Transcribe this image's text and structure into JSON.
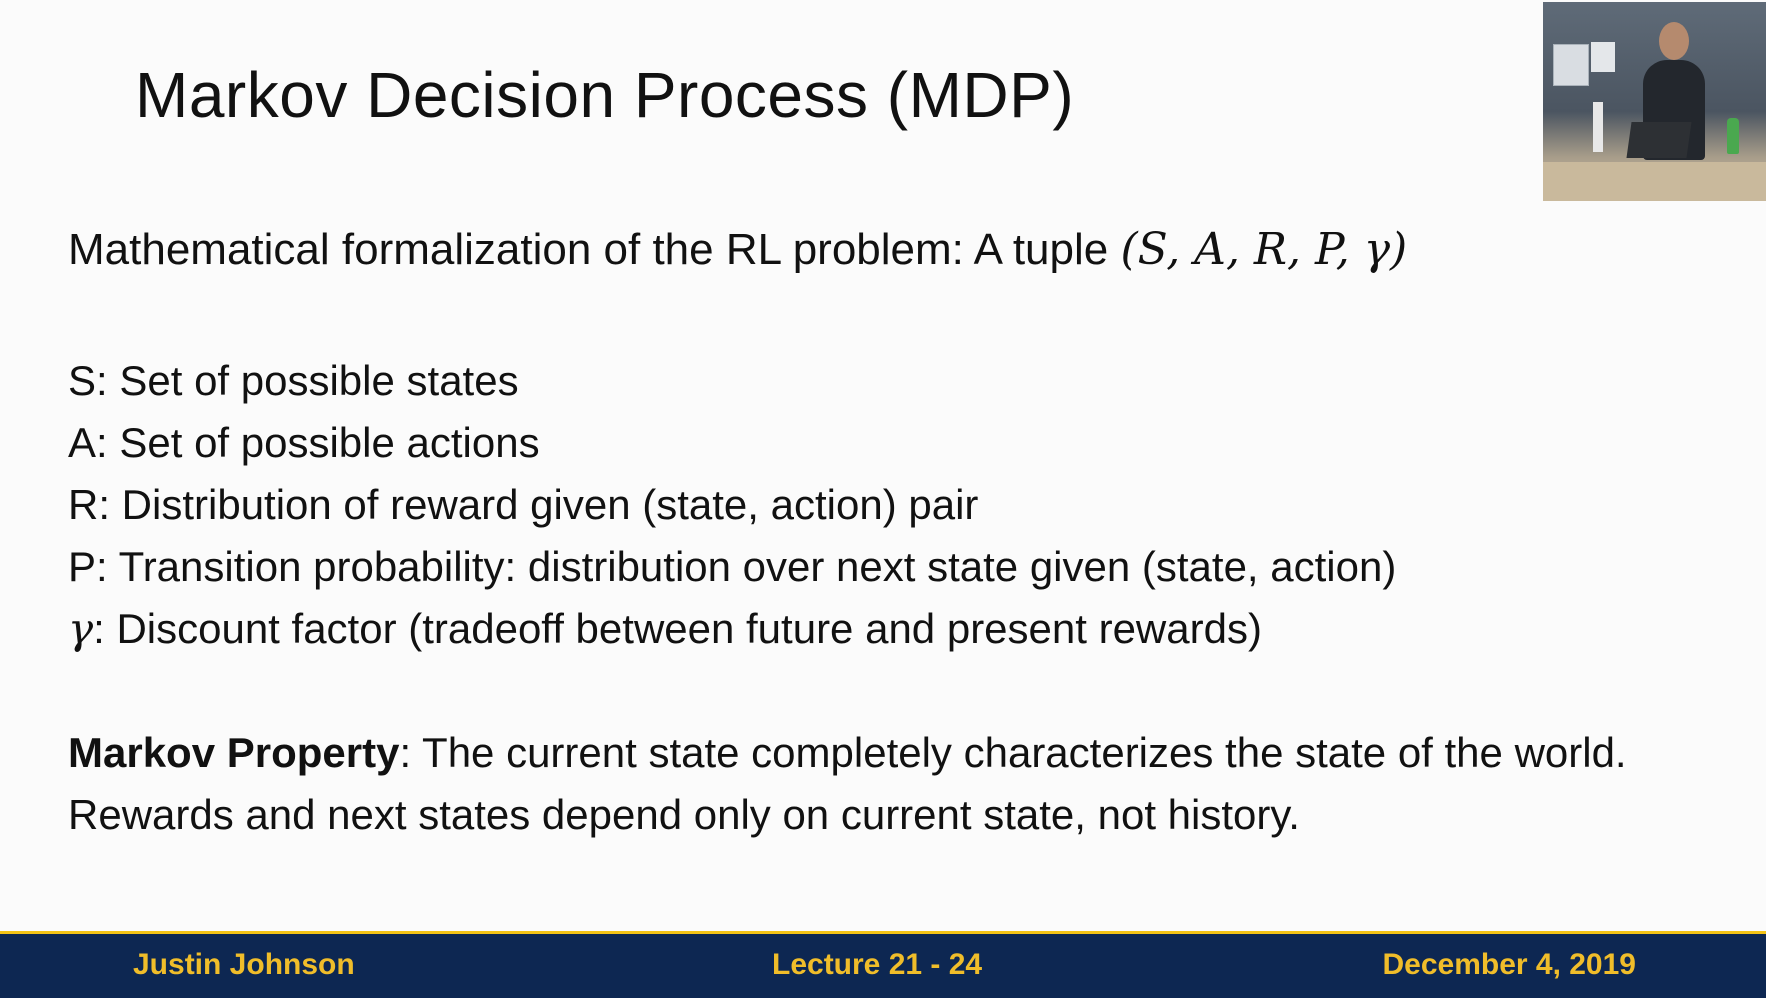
{
  "slide": {
    "title": "Markov Decision Process (MDP)",
    "intro": {
      "text": "Mathematical formalization of the RL problem: A tuple ",
      "tuple": "(S, A, R, P, γ)"
    },
    "definitions": [
      {
        "symbol": "S",
        "text": ": Set of possible states"
      },
      {
        "symbol": "A",
        "text": ": Set of possible actions"
      },
      {
        "symbol": "R",
        "text": ": Distribution of reward given (state, action) pair"
      },
      {
        "symbol": "P",
        "text": ": Transition probability: distribution over next state given (state, action)"
      },
      {
        "symbol": "γ",
        "text": ": Discount factor (tradeoff between future and present rewards)"
      }
    ],
    "property": {
      "term": "Markov Property",
      "text": ": The current state completely characterizes the state of the world. Rewards and next states depend only on current state, not history."
    }
  },
  "footer": {
    "author": "Justin Johnson",
    "lecture": "Lecture 21 - 24",
    "date": "December 4, 2019"
  },
  "colors": {
    "footer_background": "#0d2752",
    "footer_text": "#f0bd2a",
    "footer_rule": "#f3c316"
  }
}
